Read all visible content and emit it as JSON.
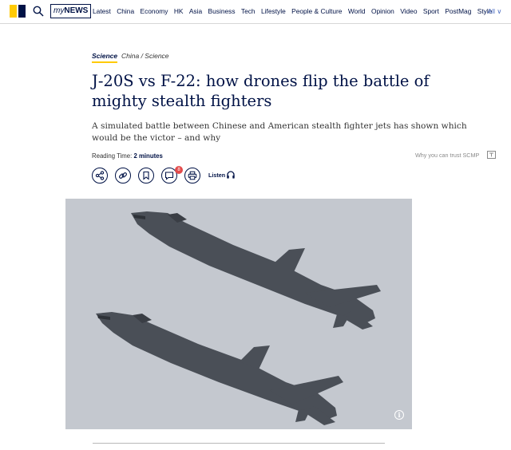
{
  "nav": {
    "mynews_prefix": "my",
    "mynews_bold": "NEWS",
    "items": [
      "Latest",
      "China",
      "Economy",
      "HK",
      "Asia",
      "Business",
      "Tech",
      "Lifestyle",
      "People & Culture",
      "World",
      "Opinion",
      "Video",
      "Sport",
      "PostMag",
      "Style"
    ],
    "all_label": "· All ∨"
  },
  "article": {
    "section": "Science",
    "subsection": "China / Science",
    "title": "J-20S vs F-22: how drones flip the battle of mighty stealth fighters",
    "subtitle": "A simulated battle between Chinese and American stealth fighter jets has shown which would be the victor – and why",
    "reading_label": "Reading Time:",
    "reading_value": "2 minutes",
    "trust_text": "Why you can trust SCMP",
    "comment_count": "8",
    "listen_label": "Listen"
  },
  "icons": {
    "logo": "scmp-logo",
    "search": "search-icon",
    "share": "share-icon",
    "link": "link-icon",
    "bookmark": "bookmark-icon",
    "comment": "comment-icon",
    "print": "print-icon",
    "headphones": "headphones-icon",
    "info": "info-icon"
  },
  "colors": {
    "brand_navy": "#001246",
    "brand_yellow": "#FFCA05",
    "badge_red": "#e34b4b",
    "sky": "#c4c8cf",
    "jet": "#4a4f57"
  }
}
